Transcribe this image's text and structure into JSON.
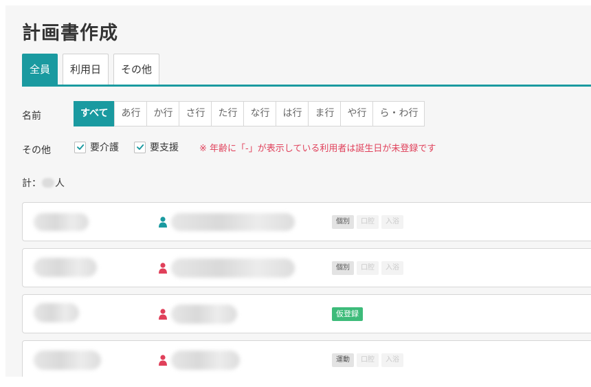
{
  "page_title": "計画書作成",
  "tabs": [
    "全員",
    "利用日",
    "その他"
  ],
  "filters": {
    "name_label": "名前",
    "name_options": [
      "すべて",
      "あ行",
      "か行",
      "さ行",
      "た行",
      "な行",
      "は行",
      "ま行",
      "や行",
      "ら・わ行"
    ],
    "other_label": "その他",
    "checkboxes": [
      {
        "label": "要介護",
        "checked": true
      },
      {
        "label": "要支援",
        "checked": true
      }
    ],
    "notice": "※ 年齢に「-」が表示している利用者は誕生日が未登録です"
  },
  "total": {
    "prefix": "計：",
    "suffix": "人"
  },
  "colors": {
    "accent": "#1a9aa0",
    "male": "#1a9aa0",
    "female": "#e0405a",
    "provisional": "#3dbb7a"
  },
  "rows": [
    {
      "gender": "male",
      "tags": [
        {
          "label": "個別",
          "state": "on"
        },
        {
          "label": "口腔",
          "state": "off"
        },
        {
          "label": "入浴",
          "state": "off"
        }
      ]
    },
    {
      "gender": "female",
      "tags": [
        {
          "label": "個別",
          "state": "on"
        },
        {
          "label": "口腔",
          "state": "off"
        },
        {
          "label": "入浴",
          "state": "off"
        }
      ]
    },
    {
      "gender": "female",
      "tags": [
        {
          "label": "仮登録",
          "state": "green"
        }
      ]
    },
    {
      "gender": "female",
      "tags": [
        {
          "label": "運動",
          "state": "on"
        },
        {
          "label": "口腔",
          "state": "off"
        },
        {
          "label": "入浴",
          "state": "off"
        }
      ]
    }
  ]
}
